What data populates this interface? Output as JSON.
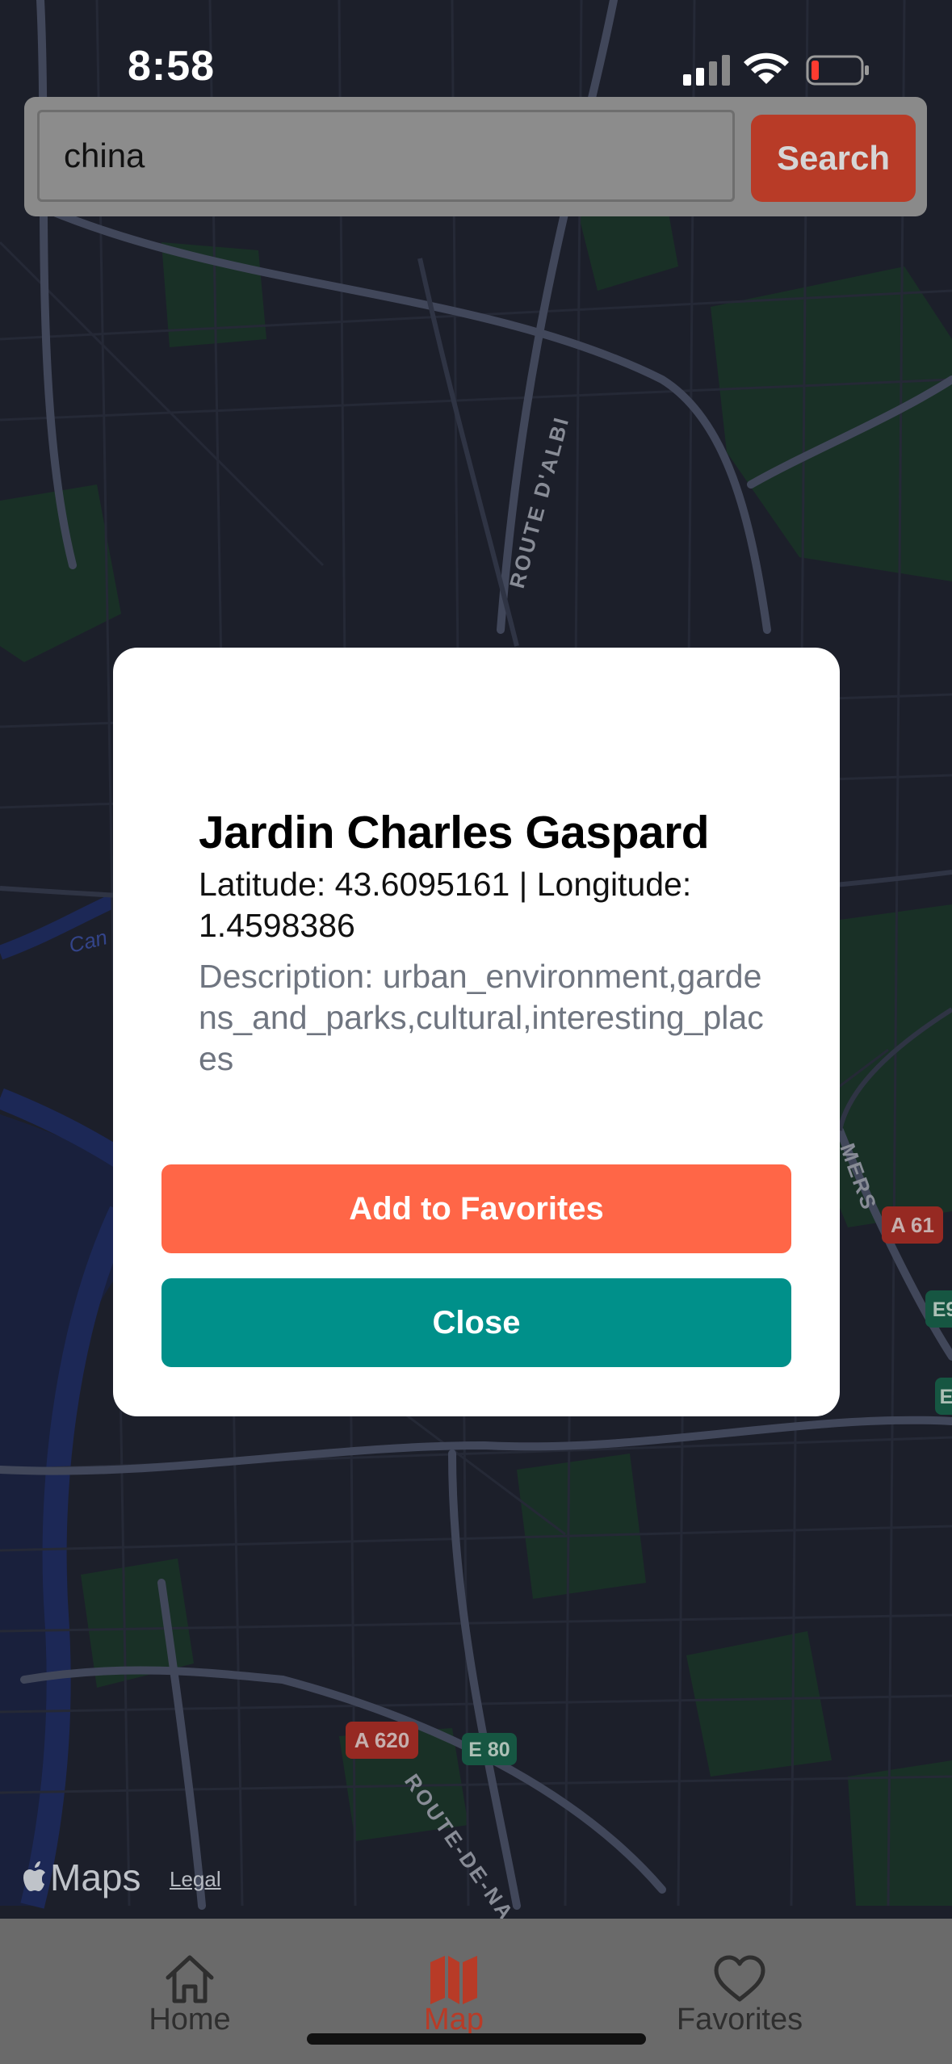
{
  "status_bar": {
    "time": "8:58"
  },
  "search": {
    "value": "china",
    "button_label": "Search"
  },
  "map": {
    "labels": [
      "ROUTE D'ALBI",
      "ROUTE-DE-NA",
      "MERS",
      "Can"
    ],
    "road_shields": [
      "A 620",
      "E 80",
      "A 61",
      "E9",
      "E"
    ]
  },
  "popup": {
    "title": "Jardin Charles Gaspard",
    "coordinates": "Latitude: 43.6095161 | Longitude: 1.4598386",
    "description": "Description: urban_environment,gardens_and_parks,cultural,interesting_places",
    "add_favorites_label": "Add to Favorites",
    "close_label": "Close"
  },
  "attribution": {
    "maps_label": "Maps",
    "legal_label": "Legal"
  },
  "tabbar": {
    "tabs": [
      {
        "label": "Home",
        "icon": "home-icon"
      },
      {
        "label": "Map",
        "icon": "map-icon",
        "active": true
      },
      {
        "label": "Favorites",
        "icon": "heart-icon"
      }
    ]
  },
  "colors": {
    "accent": "#ff6647",
    "search_button": "#b83b27",
    "close_button": "#00908a",
    "map_background": "#1f2330"
  }
}
